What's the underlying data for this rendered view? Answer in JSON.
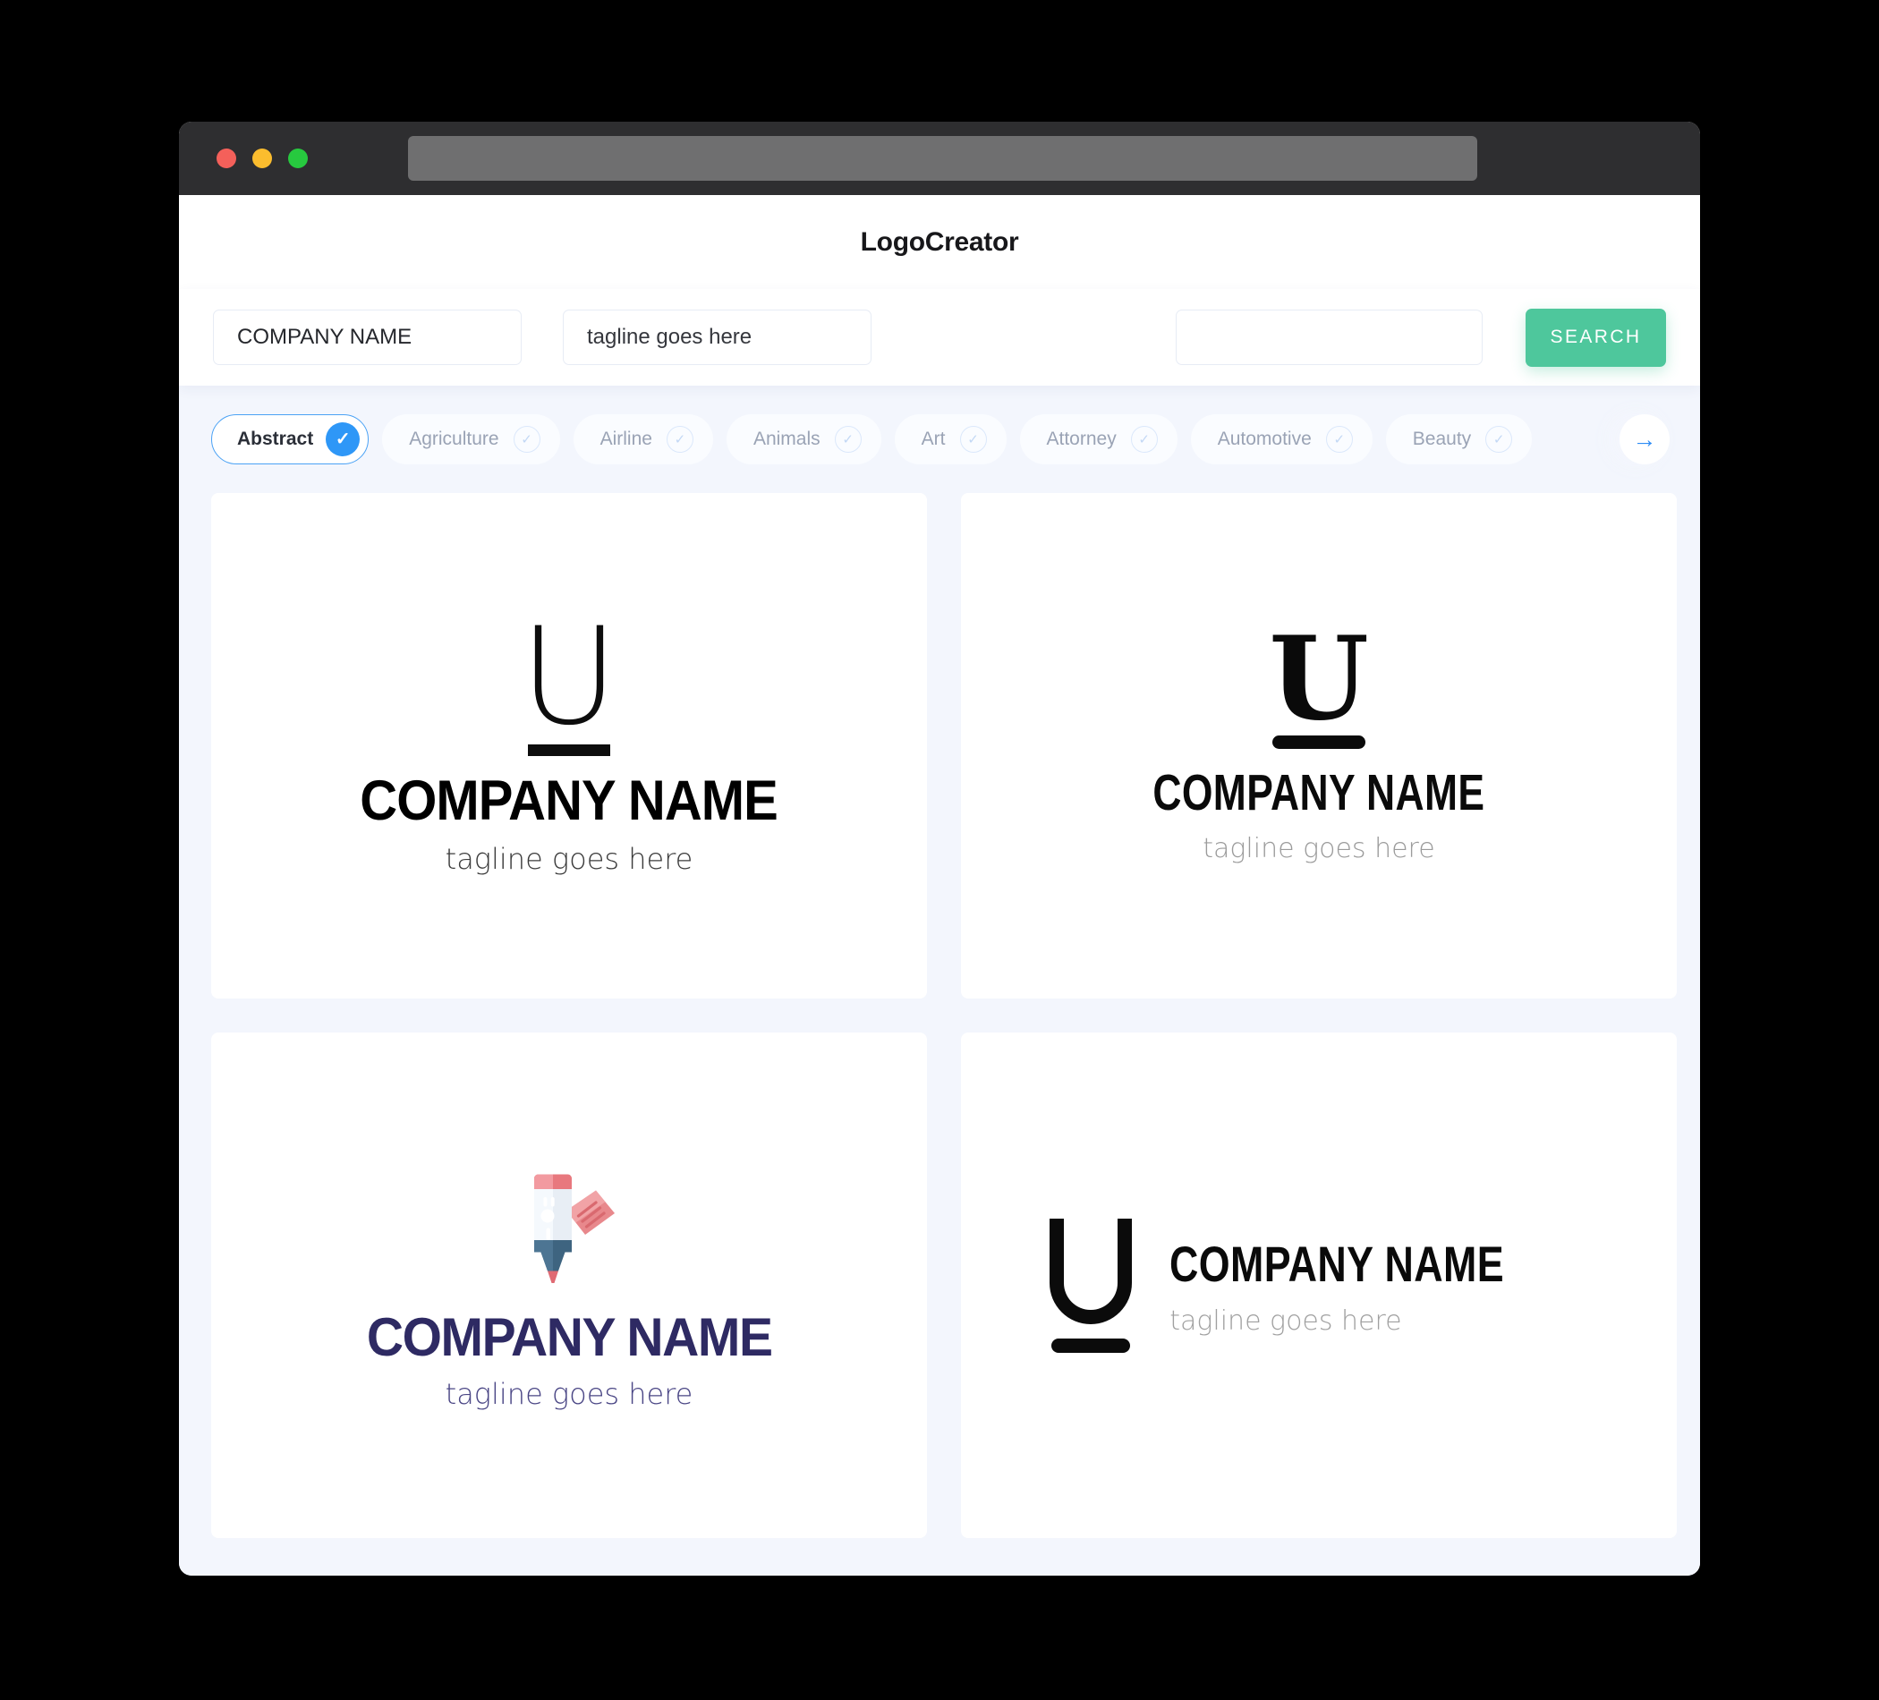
{
  "window": {
    "traffic_lights": [
      "close",
      "minimize",
      "maximize"
    ],
    "url_bar_value": ""
  },
  "header": {
    "app_title": "LogoCreator"
  },
  "search": {
    "company_name_value": "COMPANY NAME",
    "company_name_placeholder": "COMPANY NAME",
    "tagline_value": "tagline goes here",
    "tagline_placeholder": "tagline goes here",
    "keyword_value": "",
    "keyword_placeholder": "",
    "search_button_label": "SEARCH"
  },
  "categories": {
    "next_arrow_icon": "arrow-right-icon",
    "items": [
      {
        "label": "Abstract",
        "selected": true,
        "check_icon": "check-icon"
      },
      {
        "label": "Agriculture",
        "selected": false,
        "check_icon": "check-icon"
      },
      {
        "label": "Airline",
        "selected": false,
        "check_icon": "check-icon"
      },
      {
        "label": "Animals",
        "selected": false,
        "check_icon": "check-icon"
      },
      {
        "label": "Art",
        "selected": false,
        "check_icon": "check-icon"
      },
      {
        "label": "Attorney",
        "selected": false,
        "check_icon": "check-icon"
      },
      {
        "label": "Automotive",
        "selected": false,
        "check_icon": "check-icon"
      },
      {
        "label": "Beauty",
        "selected": false,
        "check_icon": "check-icon"
      }
    ]
  },
  "results": {
    "cards": [
      {
        "id": "logo-card-1",
        "mark_letter": "U",
        "mark_style": "sans-underline",
        "company_name": "COMPANY NAME",
        "tagline": "tagline goes here",
        "name_color": "#000000",
        "tagline_color": "#3b3b3b"
      },
      {
        "id": "logo-card-2",
        "mark_letter": "U",
        "mark_style": "serif-underline",
        "company_name": "COMPANY NAME",
        "tagline": "tagline goes here",
        "name_color": "#0a0a0a",
        "tagline_color": "#9b9b9b"
      },
      {
        "id": "logo-card-3",
        "mark_letter": "",
        "mark_style": "marker-icon",
        "icon_name": "highlighter-marker-icon",
        "company_name": "COMPANY NAME",
        "tagline": "tagline goes here",
        "name_color": "#2e2a63",
        "tagline_color": "#4a4685"
      },
      {
        "id": "logo-card-4",
        "mark_letter": "U",
        "mark_style": "rounded-horizontal",
        "company_name": "COMPANY NAME",
        "tagline": "tagline goes here",
        "name_color": "#0a0a0a",
        "tagline_color": "#a0a0a0"
      }
    ]
  },
  "colors": {
    "accent_green": "#4ec79c",
    "accent_blue": "#2e97f7",
    "page_bg": "#f3f6fd",
    "titlebar": "#2e2e30",
    "navy": "#2e2a63"
  }
}
